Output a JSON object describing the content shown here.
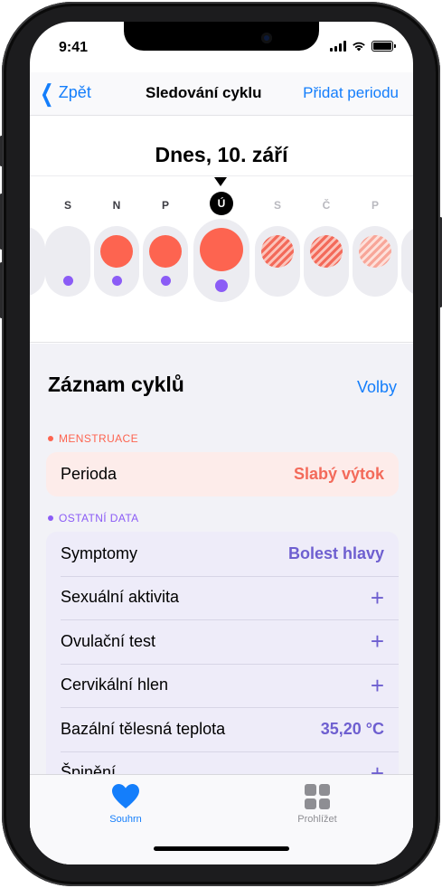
{
  "status": {
    "time": "9:41"
  },
  "nav": {
    "back_label": "Zpět",
    "title": "Sledování cyklu",
    "action_label": "Přidat periodu"
  },
  "calendar": {
    "date_heading": "Dnes, 10. září",
    "days": [
      {
        "letter": "",
        "flow": "none",
        "dot": false
      },
      {
        "letter": "S",
        "flow": "none",
        "dot": true
      },
      {
        "letter": "N",
        "flow": "logged",
        "dot": true
      },
      {
        "letter": "P",
        "flow": "logged",
        "dot": true
      },
      {
        "letter": "Ú",
        "flow": "logged",
        "dot": true,
        "today": true
      },
      {
        "letter": "S",
        "flow": "predicted",
        "dot": false
      },
      {
        "letter": "Č",
        "flow": "predicted",
        "dot": false
      },
      {
        "letter": "P",
        "flow": "predicted-light",
        "dot": false
      },
      {
        "letter": "",
        "flow": "none",
        "dot": false
      }
    ]
  },
  "log": {
    "title": "Záznam cyklů",
    "options_label": "Volby",
    "menstruation": {
      "label": "MENSTRUACE",
      "color": "#fd6450",
      "rows": [
        {
          "label": "Perioda",
          "value": "Slabý výtok"
        }
      ]
    },
    "other": {
      "label": "OSTATNÍ DATA",
      "color": "#8b5cf6",
      "rows": [
        {
          "label": "Symptomy",
          "value": "Bolest hlavy"
        },
        {
          "label": "Sexuální aktivita",
          "value": "+"
        },
        {
          "label": "Ovulační test",
          "value": "+"
        },
        {
          "label": "Cervikální hlen",
          "value": "+"
        },
        {
          "label": "Bazální tělesná teplota",
          "value": "35,20 °C"
        },
        {
          "label": "Špinění",
          "value": "+"
        }
      ]
    }
  },
  "tabbar": {
    "tabs": [
      {
        "label": "Souhrn",
        "icon": "heart-icon",
        "active": true
      },
      {
        "label": "Prohlížet",
        "icon": "grid-icon",
        "active": false
      }
    ]
  },
  "colors": {
    "accent": "#147efb",
    "menstruation": "#fd6450",
    "other": "#8b5cf6",
    "other_value": "#6e5fd0",
    "menstruation_value": "#f36a5a"
  }
}
